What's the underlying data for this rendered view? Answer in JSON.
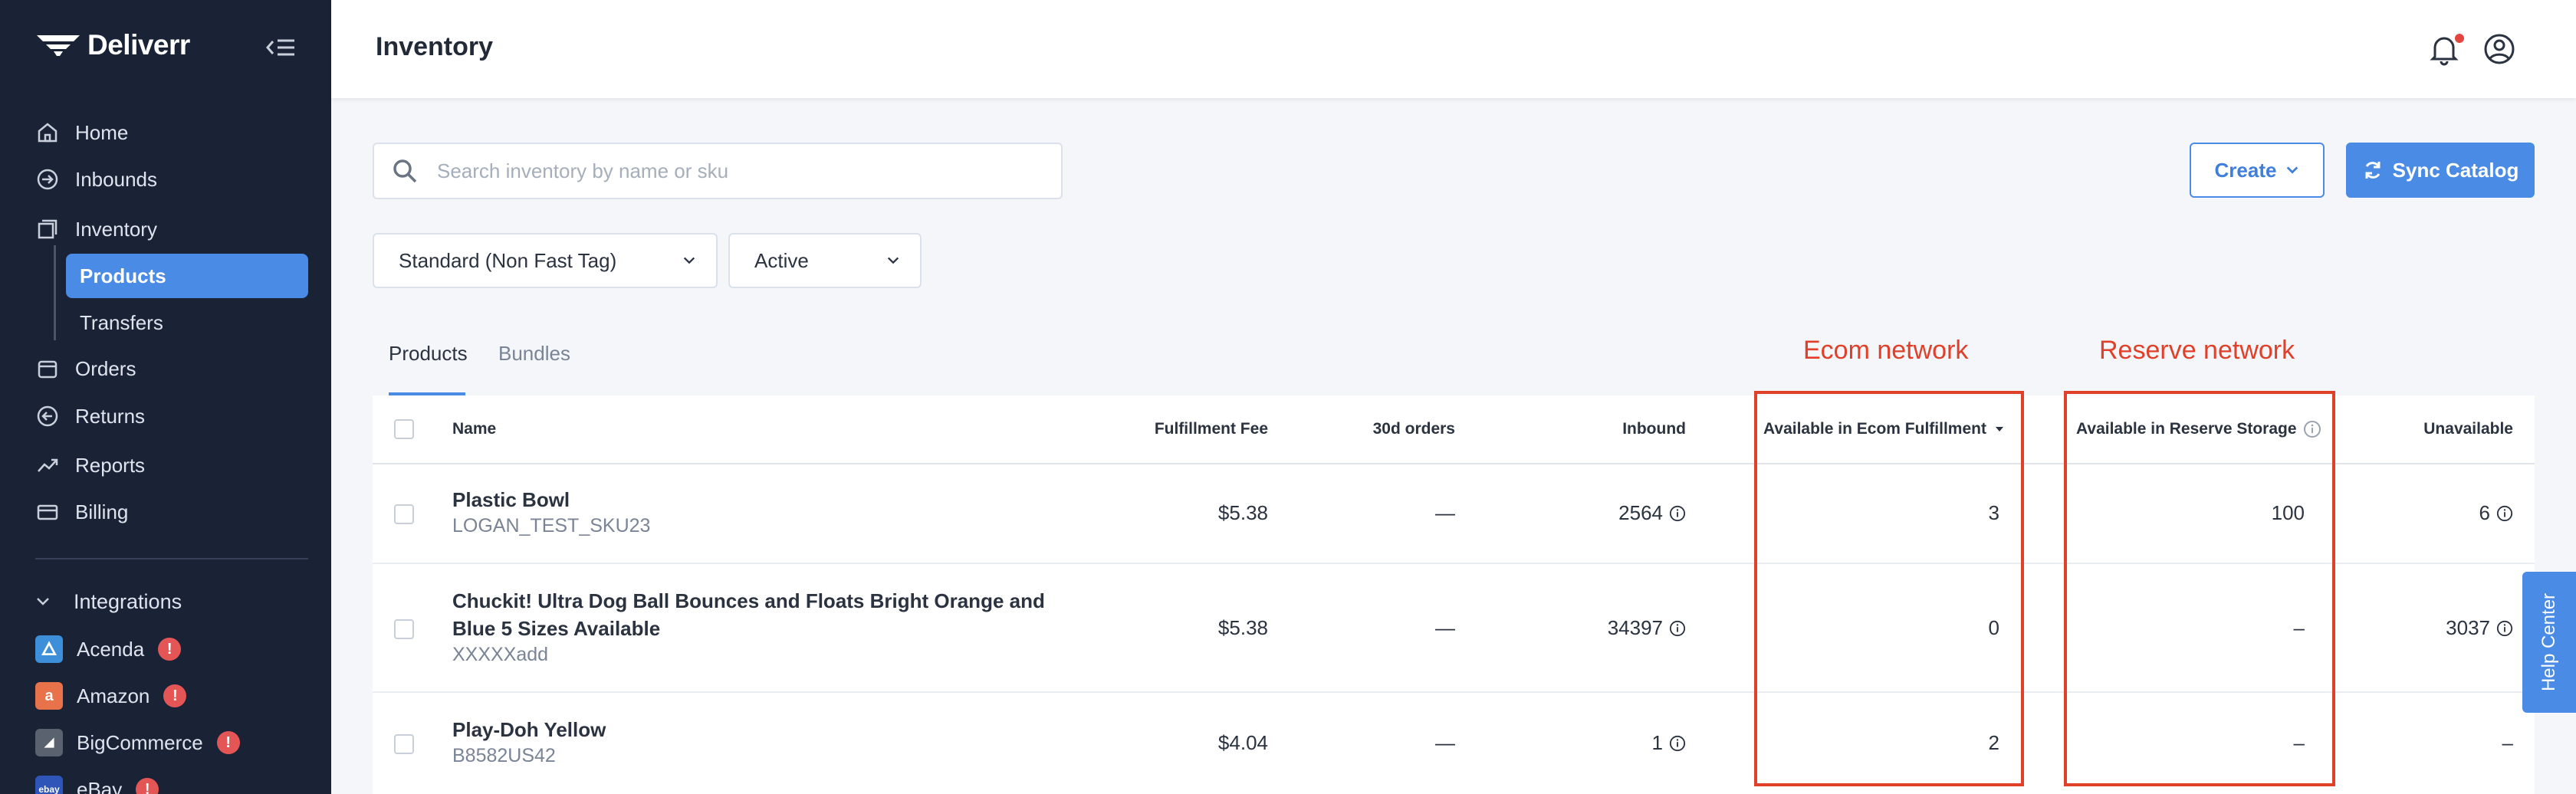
{
  "app": {
    "brand": "Deliverr",
    "page_title": "Inventory"
  },
  "sidebar": {
    "nav": [
      {
        "label": "Home",
        "icon": "home-icon"
      },
      {
        "label": "Inbounds",
        "icon": "arrow-in-icon"
      },
      {
        "label": "Inventory",
        "icon": "inventory-icon"
      }
    ],
    "sub": [
      {
        "label": "Products",
        "active": true
      },
      {
        "label": "Transfers",
        "active": false
      }
    ],
    "nav2": [
      {
        "label": "Orders",
        "icon": "orders-icon"
      },
      {
        "label": "Returns",
        "icon": "returns-icon"
      },
      {
        "label": "Reports",
        "icon": "reports-icon"
      },
      {
        "label": "Billing",
        "icon": "billing-icon"
      }
    ],
    "integrations_label": "Integrations",
    "integrations": [
      {
        "label": "Acenda",
        "logo": "acenda-logo",
        "badge": "!"
      },
      {
        "label": "Amazon",
        "logo": "amazon-logo",
        "badge": "!"
      },
      {
        "label": "BigCommerce",
        "logo": "bigcommerce-logo",
        "badge": "!"
      },
      {
        "label": "eBay",
        "logo": "ebay-logo",
        "badge": "!"
      }
    ]
  },
  "search": {
    "placeholder": "Search inventory by name or sku"
  },
  "toolbar": {
    "create_label": "Create",
    "sync_label": "Sync Catalog"
  },
  "filters": {
    "tag": "Standard (Non Fast Tag)",
    "status": "Active"
  },
  "tabs": [
    "Products",
    "Bundles"
  ],
  "table": {
    "headers": {
      "name": "Name",
      "fee": "Fulfillment Fee",
      "orders": "30d orders",
      "inbound": "Inbound",
      "ecom": "Available in Ecom Fulfillment",
      "reserve": "Available in Reserve Storage",
      "unavailable": "Unavailable"
    },
    "rows": [
      {
        "name": "Plastic Bowl",
        "sku": "LOGAN_TEST_SKU23",
        "fee": "$5.38",
        "orders": "—",
        "inbound": "2564",
        "ecom": "3",
        "reserve": "100",
        "unavailable": "6"
      },
      {
        "name": "Chuckit! Ultra Dog Ball Bounces and Floats Bright Orange and Blue 5 Sizes Available",
        "sku": "XXXXXadd",
        "fee": "$5.38",
        "orders": "—",
        "inbound": "34397",
        "ecom": "0",
        "reserve": "–",
        "unavailable": "3037"
      },
      {
        "name": "Play-Doh Yellow",
        "sku": "B8582US42",
        "fee": "$4.04",
        "orders": "—",
        "inbound": "1",
        "ecom": "2",
        "reserve": "–",
        "unavailable": "–"
      }
    ]
  },
  "annotations": {
    "ecom": "Ecom network",
    "reserve": "Reserve network",
    "color": "#e0402a"
  },
  "help": {
    "label": "Help Center"
  },
  "colors": {
    "accent": "#4a8be6",
    "sidebar": "#1a2336",
    "alert": "#e45656"
  }
}
